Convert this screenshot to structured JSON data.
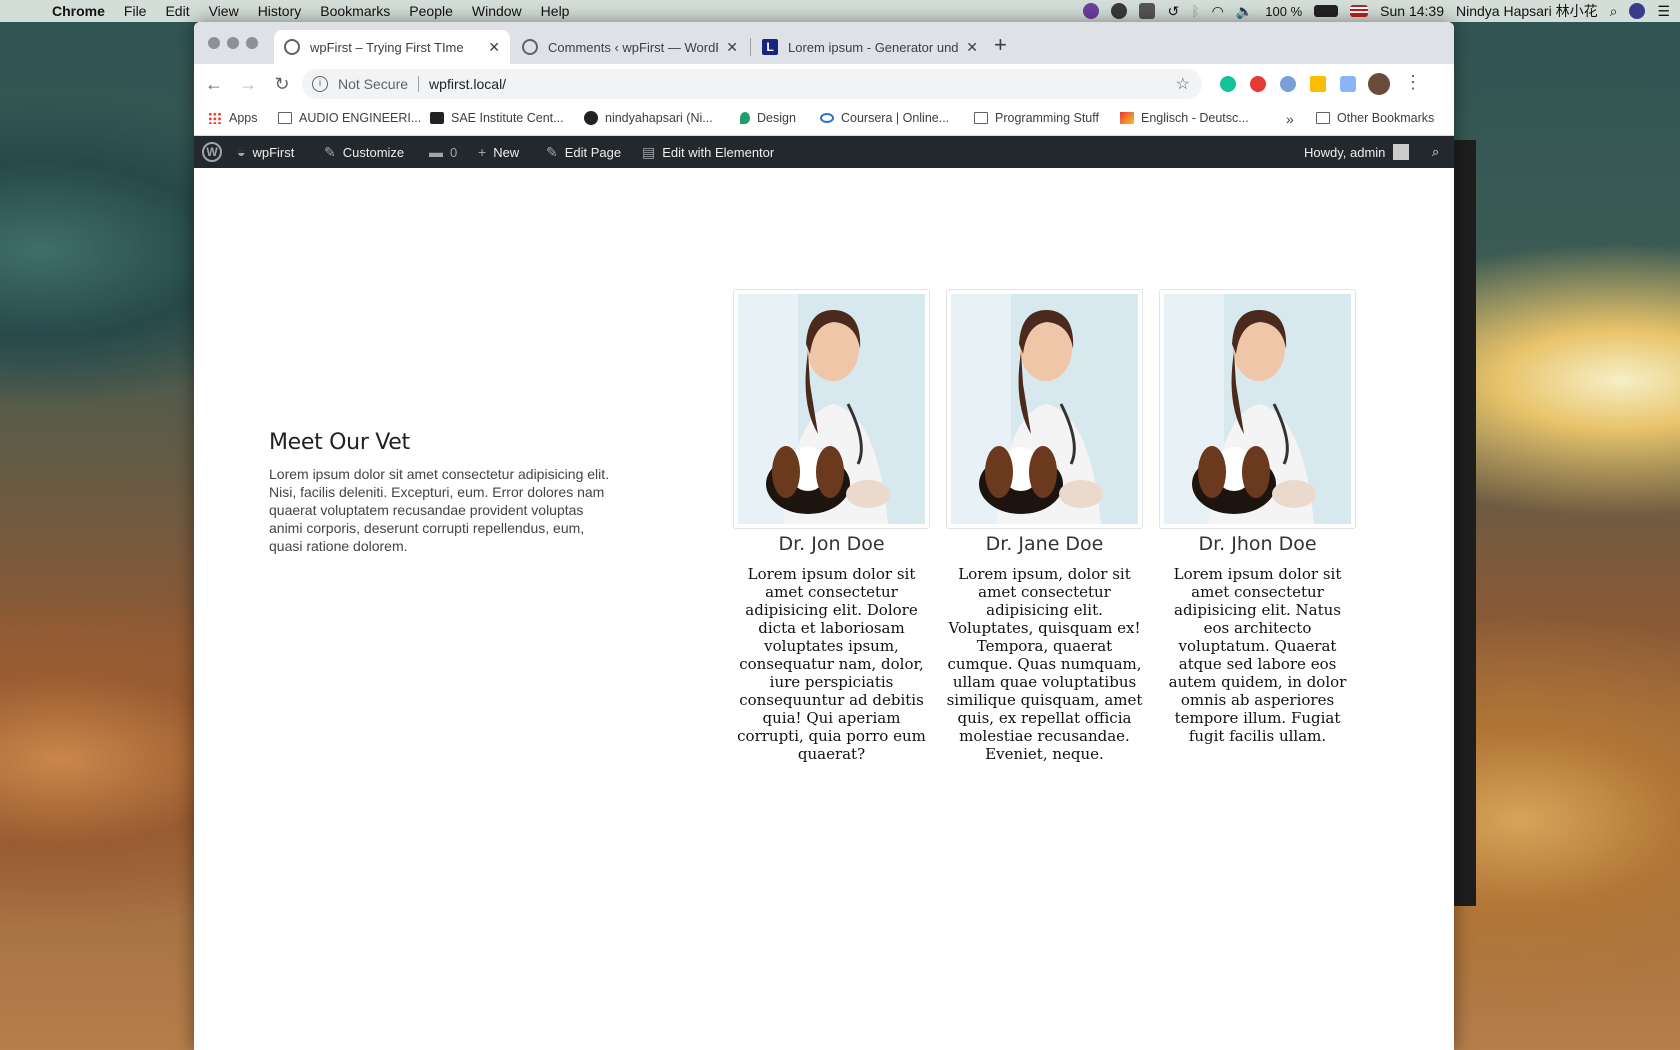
{
  "menubar": {
    "app": "Chrome",
    "items": [
      "File",
      "Edit",
      "View",
      "History",
      "Bookmarks",
      "People",
      "Window",
      "Help"
    ],
    "battery": "100 %",
    "clock": "Sun 14:39",
    "user": "Nindya Hapsari 林小花"
  },
  "tabs": [
    {
      "title": "wpFirst – Trying First TIme",
      "active": true
    },
    {
      "title": "Comments ‹ wpFirst — WordPress",
      "active": false
    },
    {
      "title": "Lorem ipsum - Generator und Info",
      "active": false
    }
  ],
  "omnibox": {
    "security": "Not Secure",
    "url": "wpfirst.local/"
  },
  "bookmarks": {
    "items": [
      "Apps",
      "AUDIO ENGINEERI...",
      "SAE Institute Cent...",
      "nindyahapsari (Ni...",
      "Design",
      "Coursera | Online...",
      "Programming Stuff",
      "Englisch - Deutsc..."
    ],
    "overflow": "»",
    "other": "Other Bookmarks"
  },
  "adminbar": {
    "site": "wpFirst",
    "customize": "Customize",
    "comments_count": "0",
    "new": "New",
    "edit_page": "Edit Page",
    "elementor": "Edit with Elementor",
    "howdy": "Howdy, admin"
  },
  "intro": {
    "heading": "Meet Our Vet",
    "text": "Lorem ipsum dolor sit amet consectetur adipisicing elit. Nisi, facilis deleniti. Excepturi, eum. Error dolores nam quaerat voluptatem recusandae provident voluptas animi corporis, deserunt corrupti repellendus, eum, quasi ratione dolorem."
  },
  "vets": [
    {
      "name": "Dr. Jon Doe",
      "bio": "Lorem ipsum dolor sit amet consectetur adipisicing elit. Dolore dicta et laboriosam voluptates ipsum, consequatur nam, dolor, iure perspiciatis consequuntur ad debitis quia! Qui aperiam corrupti, quia porro eum quaerat?"
    },
    {
      "name": "Dr. Jane Doe",
      "bio": "Lorem ipsum, dolor sit amet consectetur adipisicing elit. Voluptates, quisquam ex! Tempora, quaerat cumque. Quas numquam, ullam quae voluptatibus similique quisquam, amet quis, ex repellat officia molestiae recusandae. Eveniet, neque."
    },
    {
      "name": "Dr. Jhon Doe",
      "bio": "Lorem ipsum dolor sit amet consectetur adipisicing elit. Natus eos architecto voluptatum. Quaerat atque sed labore eos autem quidem, in dolor omnis ab asperiores tempore illum. Fugiat fugit facilis ullam."
    }
  ]
}
